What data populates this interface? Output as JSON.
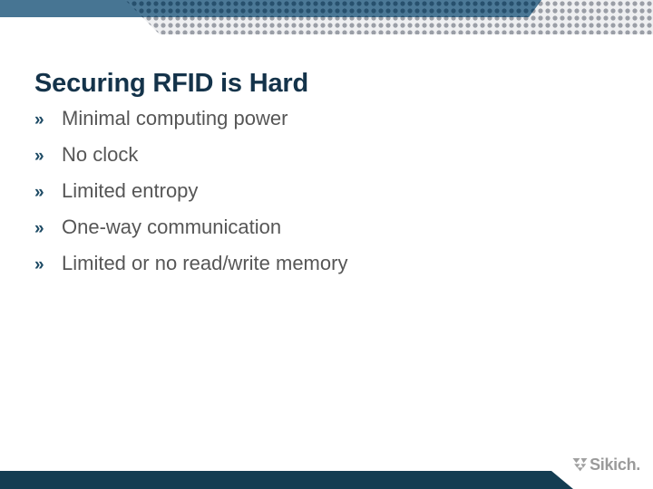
{
  "slide": {
    "title": "Securing RFID is Hard",
    "bullets": [
      {
        "marker": "»",
        "text": "Minimal computing power"
      },
      {
        "marker": "»",
        "text": "No clock"
      },
      {
        "marker": "»",
        "text": "Limited entropy"
      },
      {
        "marker": "»",
        "text": "One-way communication"
      },
      {
        "marker": "»",
        "text": "Limited or no read/write memory"
      }
    ]
  },
  "branding": {
    "logo_text": "Sikich.",
    "logo_mark_icon": "double-chevron-down-icon"
  },
  "decoration": {
    "header_band_icon": "angled-blue-band",
    "header_dots_icon": "polka-dot-pattern",
    "footer_band_icon": "angled-navy-band"
  },
  "colors": {
    "header_band_blue": "#477593",
    "header_dots_navy": "#2d5c7a",
    "header_dots_gray": "#9a9ea6",
    "header_dots_bg": "#eeeff1",
    "title_navy": "#14334a",
    "bullet_marker_navy": "#1d4a64",
    "bullet_text_gray": "#565656",
    "footer_navy": "#143d52",
    "logo_gray": "#9a9a9a",
    "slide_bg": "#ffffff"
  }
}
